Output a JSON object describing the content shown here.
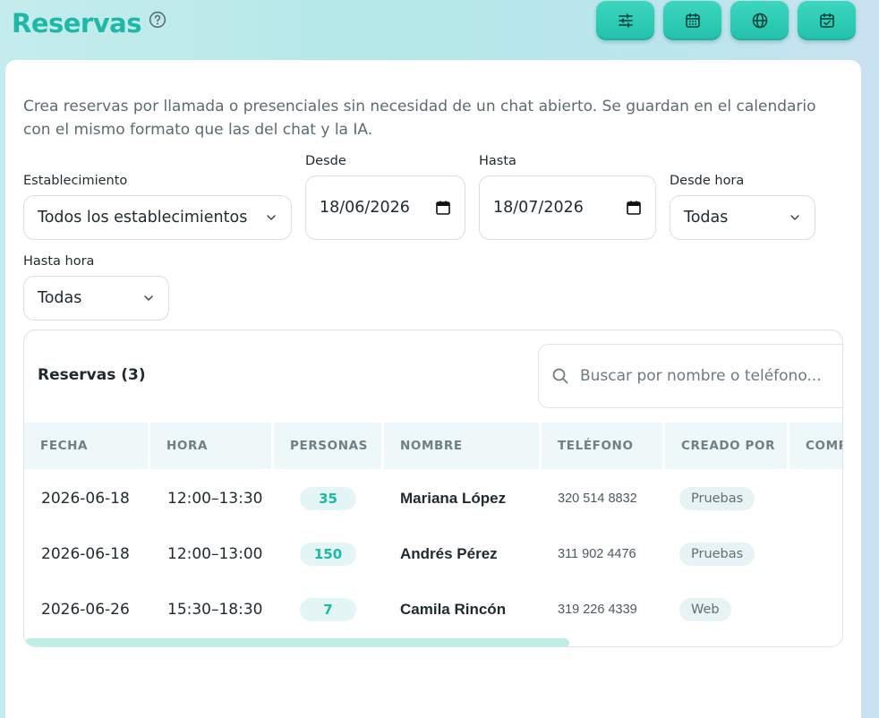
{
  "header": {
    "title": "Reservas",
    "help_icon": "question-circle-icon",
    "buttons": [
      {
        "icon": "sliders-icon"
      },
      {
        "icon": "calendar-icon"
      },
      {
        "icon": "globe-icon"
      },
      {
        "icon": "calendar-check-icon"
      }
    ]
  },
  "intro": "Crea reservas por llamada o presenciales sin necesidad de un chat abierto. Se guardan en el calendario con el mismo formato que las del chat y la IA.",
  "filters": {
    "establecimiento": {
      "label": "Establecimiento",
      "value": "Todos los establecimientos"
    },
    "desde": {
      "label": "Desde",
      "value": "18/06/2026"
    },
    "hasta": {
      "label": "Hasta",
      "value": "18/07/2026"
    },
    "desde_hora": {
      "label": "Desde hora",
      "value": "Todas"
    },
    "hasta_hora": {
      "label": "Hasta hora",
      "value": "Todas"
    }
  },
  "reservas": {
    "title": "Reservas (3)",
    "search_placeholder": "Buscar por nombre o teléfono...",
    "columns": [
      "FECHA",
      "HORA",
      "PERSONAS",
      "NOMBRE",
      "TELÉFONO",
      "CREADO POR",
      "COMP"
    ],
    "rows": [
      {
        "fecha": "2026-06-18",
        "hora": "12:00–13:30",
        "personas": "35",
        "nombre": "Mariana López",
        "telefono": "320 514 8832",
        "creado_por": "Pruebas"
      },
      {
        "fecha": "2026-06-18",
        "hora": "12:00–13:00",
        "personas": "150",
        "nombre": "Andrés Pérez",
        "telefono": "311 902 4476",
        "creado_por": "Pruebas"
      },
      {
        "fecha": "2026-06-26",
        "hora": "15:30–18:30",
        "personas": "7",
        "nombre": "Camila Rincón",
        "telefono": "319 226 4339",
        "creado_por": "Web"
      }
    ]
  },
  "colors": {
    "accent": "#1fb8a6",
    "header_bg": "#eef8f8",
    "pill_bg": "#e3f6f5"
  }
}
